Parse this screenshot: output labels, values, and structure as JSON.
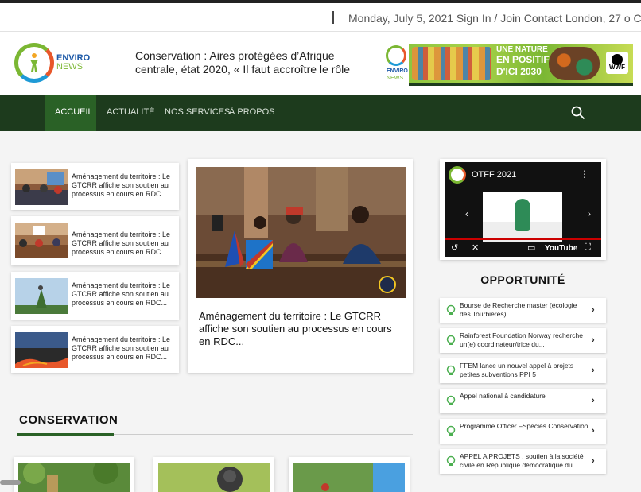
{
  "topbar": {
    "info": "Monday, July 5, 2021 Sign In / Join Contact London, 27 o C"
  },
  "logo": {
    "line1": "ENVIRO",
    "line2": "NEWS"
  },
  "header": {
    "headline": "Conservation : Aires protégées d’Afrique centrale, état 2020, « Il faut accroître le rôle"
  },
  "banner": {
    "logo_line1": "ENVIRO",
    "logo_line2": "NEWS",
    "title_line1": "UNE NATURE",
    "title_line2": "EN POSITIF",
    "title_line3": "D'ICI 2030",
    "partner": "WWF"
  },
  "nav": {
    "items": [
      {
        "label": "ACCUEIL",
        "active": true
      },
      {
        "label": "ACTUALITÉ"
      },
      {
        "label": "NOS SERVICES"
      },
      {
        "label": "À PROPOS"
      }
    ],
    "search_icon": "search-icon"
  },
  "articles": {
    "small": [
      {
        "title": "Aménagement du territoire : Le GTCRR affiche son soutien au processus en cours en RDC..."
      },
      {
        "title": "Aménagement du territoire : Le GTCRR affiche son soutien au processus en cours en RDC..."
      },
      {
        "title": "Aménagement du territoire : Le GTCRR affiche son soutien au processus en cours en RDC..."
      },
      {
        "title": "Aménagement du territoire : Le GTCRR affiche son soutien au processus en cours en RDC..."
      }
    ],
    "main": {
      "title": "Aménagement du territoire : Le GTCRR affiche son soutien au processus en cours en RDC..."
    }
  },
  "video": {
    "title": "OTFF 2021",
    "platform": "YouTube"
  },
  "opportunities": {
    "heading": "OPPORTUNITÉ",
    "items": [
      {
        "label": "Bourse de Recherche master (écologie des Tourbieres)..."
      },
      {
        "label": "Rainforest Foundation Norway recherche un(e) coordinateur/trice du..."
      },
      {
        "label": "FFEM lance un nouvel appel à projets petites subventions PPI 5"
      },
      {
        "label": "Appel national à candidature"
      },
      {
        "label": "Programme Officer –Species Conservation"
      },
      {
        "label": "APPEL A PROJETS , soutien à la société civile en République démocratique du..."
      }
    ]
  },
  "section": {
    "title": "CONSERVATION"
  }
}
